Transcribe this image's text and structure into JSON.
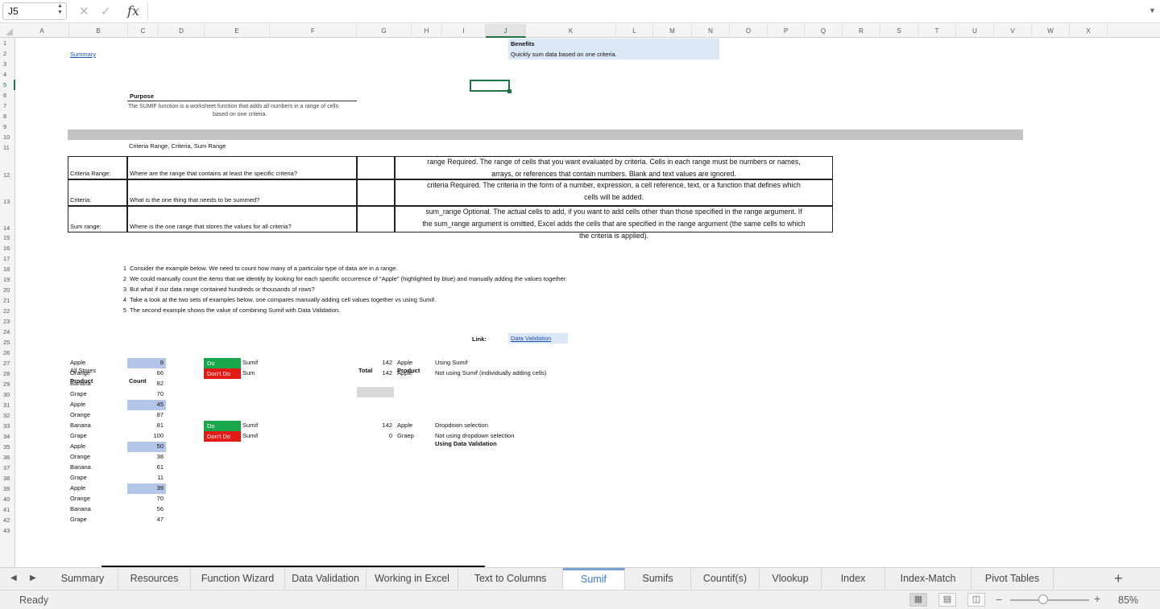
{
  "formula_bar": {
    "cell_ref": "J5",
    "formula": "",
    "fx": "fx",
    "cancel": "✕",
    "confirm": "✓"
  },
  "columns": [
    "A",
    "B",
    "C",
    "D",
    "E",
    "F",
    "G",
    "H",
    "I",
    "J",
    "K",
    "L",
    "M",
    "N",
    "O",
    "P",
    "Q",
    "R",
    "S",
    "T",
    "U",
    "V",
    "W",
    "X"
  ],
  "selected_column": "J",
  "rows": [
    "1",
    "2",
    "3",
    "4",
    "5",
    "6",
    "7",
    "8",
    "9",
    "10",
    "11",
    "12",
    "13",
    "14",
    "15",
    "16",
    "17",
    "18",
    "19",
    "20",
    "21",
    "22",
    "23",
    "24",
    "25",
    "26",
    "27",
    "28",
    "29",
    "30",
    "31",
    "32",
    "33",
    "34",
    "35",
    "36",
    "37",
    "38",
    "39",
    "40",
    "41",
    "42",
    "43"
  ],
  "selected_row": "5",
  "sheet": {
    "summary_link": "Summary",
    "benefits_title": "Benefits",
    "benefits_text": "Quickly sum data based on one criteria.",
    "purpose_title": "Purpose",
    "purpose_text_1": "The SUMIF function is a worksheet function that adds all numbers in a range of cells",
    "purpose_text_2": "based on one criteria.",
    "syntax": "Criteria Range, Criteria, Sum Range",
    "args": [
      {
        "label": "Criteria Range:",
        "question": "Where are the range that contains at least the specific criteria?",
        "desc_1": "range   Required. The range of cells that you want evaluated by criteria. Cells in each range must be numbers or names,",
        "desc_2": "arrays, or references that contain numbers. Blank and text values are ignored.",
        "desc_3": ""
      },
      {
        "label": "Criteria:",
        "question": "What is the one thing that needs to be summed?",
        "desc_1": "criteria   Required. The criteria in the form of a number, expression, a cell reference, text, or a function that defines which",
        "desc_2": "cells will be added.",
        "desc_3": ""
      },
      {
        "label": "Sum range:",
        "question": "Where is the one range that stores the values for all criteria?",
        "desc_1": "sum_range   Optional. The actual cells to add, if you want to add cells other than those specified in the range argument. If",
        "desc_2": "the sum_range argument is omitted, Excel adds the cells that are specified in the range argument (the same cells to which",
        "desc_3": "the criteria is applied)."
      }
    ],
    "steps": [
      {
        "n": "1",
        "text": "Consider the example below. We need to count how many of a particular type of data are in a range."
      },
      {
        "n": "2",
        "text": "We could manually count the items that we identify by looking for each specific occurrence of \"Apple\" (highlighted by blue) and manually adding the values together."
      },
      {
        "n": "3",
        "text": "But what if our data range contained hundreds or thousands of rows?"
      },
      {
        "n": "4",
        "text": "Take a look at the two sets of examples below, one compares manually adding cell values together vs using Sumif."
      },
      {
        "n": "5",
        "text": "The second example shows the value of combining Sumif with Data Validation."
      }
    ],
    "link_label": "Link:",
    "link_text": "Data Validation",
    "all_stores": "All Stores",
    "product_hdr": "Product",
    "count_hdr": "Count",
    "data_rows": [
      {
        "product": "Apple",
        "count": "8",
        "hl": true
      },
      {
        "product": "Orange",
        "count": "66",
        "hl": false
      },
      {
        "product": "Banana",
        "count": "82",
        "hl": false
      },
      {
        "product": "Grape",
        "count": "70",
        "hl": false
      },
      {
        "product": "Apple",
        "count": "45",
        "hl": true
      },
      {
        "product": "Orange",
        "count": "87",
        "hl": false
      },
      {
        "product": "Banana",
        "count": "81",
        "hl": false
      },
      {
        "product": "Grape",
        "count": "100",
        "hl": false
      },
      {
        "product": "Apple",
        "count": "50",
        "hl": true
      },
      {
        "product": "Orange",
        "count": "38",
        "hl": false
      },
      {
        "product": "Banana",
        "count": "61",
        "hl": false
      },
      {
        "product": "Grape",
        "count": "11",
        "hl": false
      },
      {
        "product": "Apple",
        "count": "39",
        "hl": true
      },
      {
        "product": "Orange",
        "count": "70",
        "hl": false
      },
      {
        "product": "Banana",
        "count": "56",
        "hl": false
      },
      {
        "product": "Grape",
        "count": "47",
        "hl": false
      }
    ],
    "total_hdr": "Total",
    "product_hdr2": "Product",
    "ex1": [
      {
        "tag": "Do",
        "fn": "Sumif",
        "total": "142",
        "product": "Apple",
        "note": "Using Sumif"
      },
      {
        "tag": "Don't Do",
        "fn": "Sum",
        "total": "142",
        "product": "Apple",
        "note": "Not using Sumif (individually adding cells)"
      }
    ],
    "dv_title": "Using Data Validation",
    "ex2": [
      {
        "tag": "Do",
        "fn": "Sumif",
        "total": "142",
        "product": "Apple",
        "note": "Dropdown selection"
      },
      {
        "tag": "Don't Do",
        "fn": "Sumif",
        "total": "0",
        "product": "Graep",
        "note": "Not using dropdown selection"
      }
    ]
  },
  "tabs": [
    "Summary",
    "Resources",
    "Function Wizard",
    "Data Validation",
    "Working in Excel",
    "Text to Columns",
    "Sumif",
    "Sumifs",
    "Countif(s)",
    "Vlookup",
    "Index",
    "Index-Match",
    "Pivot Tables"
  ],
  "active_tab": "Sumif",
  "add_sheet": "+",
  "status": {
    "text": "Ready",
    "zoom": "85%"
  },
  "colors": {
    "accent": "#217346",
    "highlight": "#b4c6e7",
    "do": "#18a84b",
    "dont": "#e31b17",
    "benefits_bg": "#dbe8f6",
    "banner": "#c3c3c3"
  }
}
